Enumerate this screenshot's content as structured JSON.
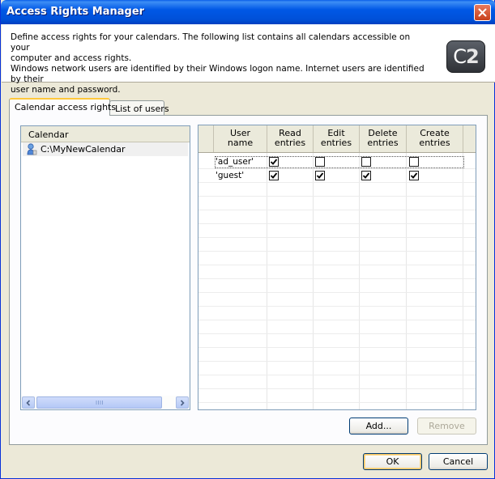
{
  "window": {
    "title": "Access Rights Manager"
  },
  "header": {
    "line1": "Define access rights for your calendars. The following list contains all calendars accessible on your",
    "line2": "computer and access rights.",
    "line3": "Windows network users are identified by their Windows logon name. Internet users are identified by their",
    "line4": "user name and password.",
    "logo_c": "C",
    "logo_2": "2"
  },
  "tabs": [
    {
      "label": "Calendar access rights",
      "active": true
    },
    {
      "label": "List of users",
      "active": false
    }
  ],
  "calendar_list": {
    "header": "Calendar",
    "items": [
      {
        "label": "C:\\MyNewCalendar",
        "selected": true
      }
    ]
  },
  "rights_table": {
    "headers": [
      {
        "l1": "User",
        "l2": "name"
      },
      {
        "l1": "Read",
        "l2": "entries"
      },
      {
        "l1": "Edit",
        "l2": "entries"
      },
      {
        "l1": "Delete",
        "l2": "entries"
      },
      {
        "l1": "Create",
        "l2": "entries"
      }
    ],
    "rows": [
      {
        "user": "'ad_user'",
        "read": true,
        "edit": false,
        "delete": false,
        "create": false
      },
      {
        "user": "'guest'",
        "read": true,
        "edit": true,
        "delete": true,
        "create": true
      }
    ]
  },
  "buttons": {
    "add": "Add...",
    "remove": "Remove",
    "ok": "OK",
    "cancel": "Cancel"
  }
}
